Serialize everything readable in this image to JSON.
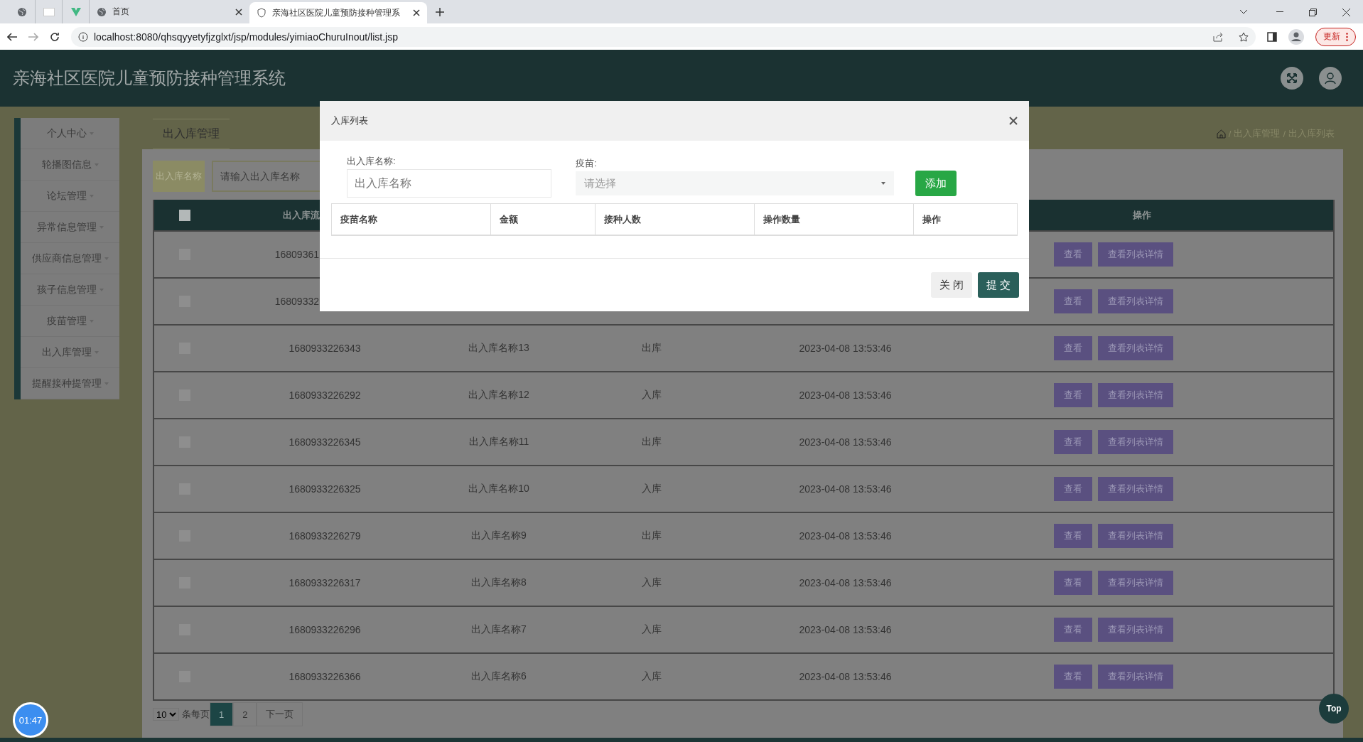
{
  "browser": {
    "tabs": [
      {
        "label": "首页",
        "selected": false
      },
      {
        "label": "亲海社区医院儿童预防接种管理系",
        "selected": true
      }
    ],
    "address": "localhost:8080/qhsqyyetyfjzglxt/jsp/modules/yimiaoChuruInout/list.jsp",
    "update": "更新"
  },
  "header": {
    "title": "亲海社区医院儿童预防接种管理系统"
  },
  "sidebar": {
    "items": [
      {
        "label": "个人中心"
      },
      {
        "label": "轮播图信息"
      },
      {
        "label": "论坛管理"
      },
      {
        "label": "异常信息管理"
      },
      {
        "label": "供应商信息管理"
      },
      {
        "label": "孩子信息管理"
      },
      {
        "label": "疫苗管理"
      },
      {
        "label": "出入库管理"
      },
      {
        "label": "提醒接种提管理"
      }
    ]
  },
  "page_tab": "出入库管理",
  "breadcrumb": {
    "separator": "/",
    "items": [
      "出入库管理",
      "出入库列表"
    ]
  },
  "search": {
    "label": "出入库名称",
    "placeholder": "请输入出入库名称"
  },
  "table": {
    "header_checked": false,
    "columns": [
      {
        "kind": "check"
      },
      {
        "kind": "cut",
        "label": "出入库流"
      },
      {
        "kind": "hidden"
      },
      {
        "kind": "hidden"
      },
      {
        "kind": "hidden"
      },
      {
        "kind": "text",
        "label": "操作"
      }
    ],
    "rows": [
      {
        "checked": false,
        "id": "16809361",
        "cut": true,
        "actions": [
          "查看",
          "查看列表详情"
        ]
      },
      {
        "checked": false,
        "id": "16809332",
        "cut": true,
        "actions": [
          "查看",
          "查看列表详情"
        ]
      },
      {
        "checked": false,
        "id": "1680933226343",
        "name": "出入库名称13",
        "type": "出库",
        "time": "2023-04-08 13:53:46",
        "actions": [
          "查看",
          "查看列表详情"
        ]
      },
      {
        "checked": false,
        "id": "1680933226292",
        "name": "出入库名称12",
        "type": "入库",
        "time": "2023-04-08 13:53:46",
        "actions": [
          "查看",
          "查看列表详情"
        ]
      },
      {
        "checked": false,
        "id": "1680933226345",
        "name": "出入库名称11",
        "type": "出库",
        "time": "2023-04-08 13:53:46",
        "actions": [
          "查看",
          "查看列表详情"
        ]
      },
      {
        "checked": false,
        "id": "1680933226325",
        "name": "出入库名称10",
        "type": "入库",
        "time": "2023-04-08 13:53:46",
        "actions": [
          "查看",
          "查看列表详情"
        ]
      },
      {
        "checked": false,
        "id": "1680933226279",
        "name": "出入库名称9",
        "type": "出库",
        "time": "2023-04-08 13:53:46",
        "actions": [
          "查看",
          "查看列表详情"
        ]
      },
      {
        "checked": false,
        "id": "1680933226317",
        "name": "出入库名称8",
        "type": "入库",
        "time": "2023-04-08 13:53:46",
        "actions": [
          "查看",
          "查看列表详情"
        ]
      },
      {
        "checked": false,
        "id": "1680933226296",
        "name": "出入库名称7",
        "type": "入库",
        "time": "2023-04-08 13:53:46",
        "actions": [
          "查看",
          "查看列表详情"
        ]
      },
      {
        "checked": false,
        "id": "1680933226366",
        "name": "出入库名称6",
        "type": "入库",
        "time": "2023-04-08 13:53:46",
        "actions": [
          "查看",
          "查看列表详情"
        ]
      }
    ]
  },
  "pagination": {
    "page_size": "10",
    "per_page_label": "条每页",
    "pages": [
      {
        "label": "1",
        "selected": true
      },
      {
        "label": "2",
        "selected": false
      }
    ],
    "next": "下一页"
  },
  "modal": {
    "title": "入库列表",
    "name_label": "出入库名称:",
    "name_placeholder": "出入库名称",
    "vaccine_label": "疫苗:",
    "vaccine_placeholder": "请选择",
    "add": "添加",
    "columns": [
      "疫苗名称",
      "金额",
      "接种人数",
      "操作数量",
      "操作"
    ],
    "buttons": [
      {
        "label": "关 闭",
        "kind": "secondary"
      },
      {
        "label": "提 交",
        "kind": "primary"
      }
    ]
  },
  "timer": "01:47",
  "top_button": "Top"
}
